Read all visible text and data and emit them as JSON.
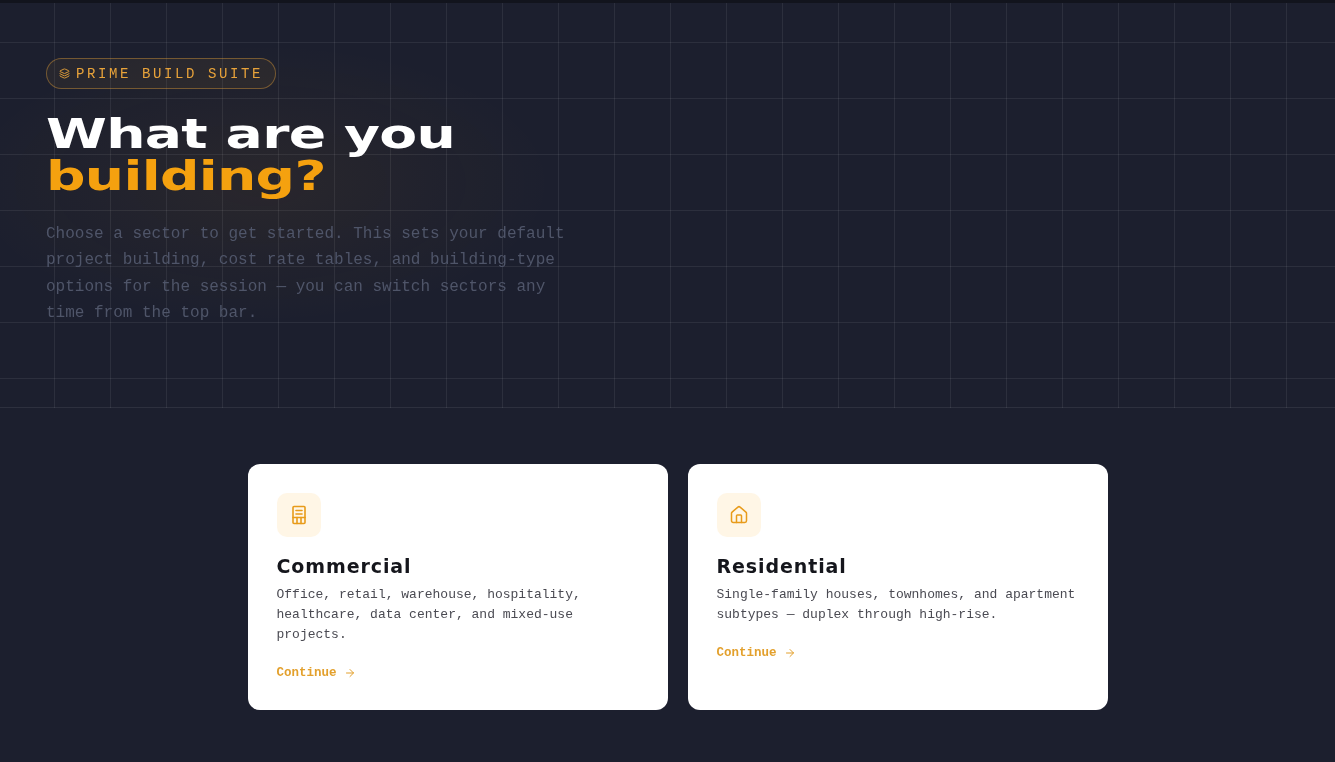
{
  "badge": {
    "label": "PRIME BUILD SUITE"
  },
  "heading": {
    "line_1": "What are you",
    "line_2": "building?"
  },
  "description": "Choose a sector to get started. This sets your default project building, cost rate tables, and building-type options for the session — you can switch sectors any time from the top bar.",
  "sectors": [
    {
      "kind": "commercial",
      "title": "Commercial",
      "description": "Office, retail, warehouse, hospitality, healthcare, data center, and mixed-use projects.",
      "link": "Continue"
    },
    {
      "kind": "residential",
      "title": "Residential",
      "description": "Single-family houses, townhomes, and apartment subtypes — duplex through high-rise.",
      "link": "Continue"
    }
  ]
}
